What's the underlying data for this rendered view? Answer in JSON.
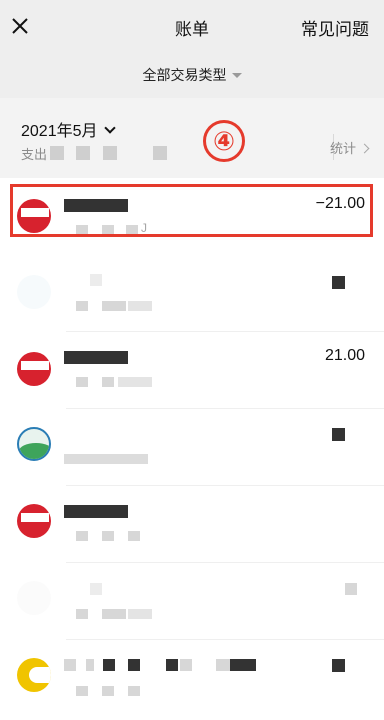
{
  "header": {
    "close_icon": "close-icon",
    "title": "账单",
    "help": "常见问题"
  },
  "filter": {
    "label": "全部交易类型"
  },
  "summary": {
    "month": "2021年5月",
    "spend_label": "支出",
    "stats_label": "统计"
  },
  "annotation": {
    "step": "④"
  },
  "transactions": [
    {
      "amount": "−21.00",
      "subtitle": "J"
    },
    {
      "amount": "",
      "subtitle": ""
    },
    {
      "amount": "21.00",
      "subtitle": ""
    },
    {
      "amount": "",
      "subtitle": ""
    },
    {
      "amount": "",
      "subtitle": ""
    },
    {
      "amount": "",
      "subtitle": ""
    },
    {
      "amount": "",
      "subtitle": ""
    }
  ],
  "colors": {
    "highlight": "#e53a2c",
    "background_gray": "#eeeeee",
    "text_secondary": "#8c8c8c"
  }
}
